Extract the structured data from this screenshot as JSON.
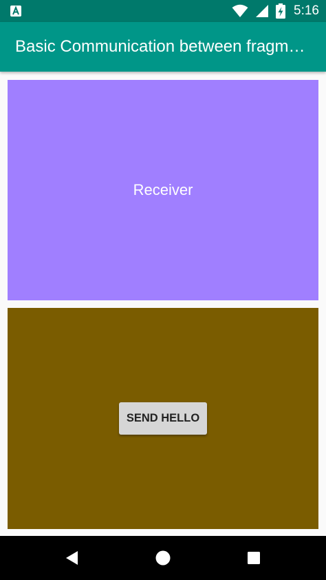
{
  "status_bar": {
    "time": "5:16",
    "icons": [
      "app-notification-icon",
      "wifi-icon",
      "signal-icon",
      "battery-charging-icon"
    ]
  },
  "app_bar": {
    "title": "Basic Communication between fragments"
  },
  "receiver": {
    "label": "Receiver",
    "background": "#a07fff"
  },
  "sender": {
    "button_label": "SEND HELLO",
    "background": "#7a5c00"
  },
  "colors": {
    "status_bar": "#00796b",
    "app_bar": "#009688",
    "nav_bar": "#000000"
  },
  "nav_bar": {
    "icons": [
      "back-icon",
      "home-icon",
      "recents-icon"
    ]
  }
}
